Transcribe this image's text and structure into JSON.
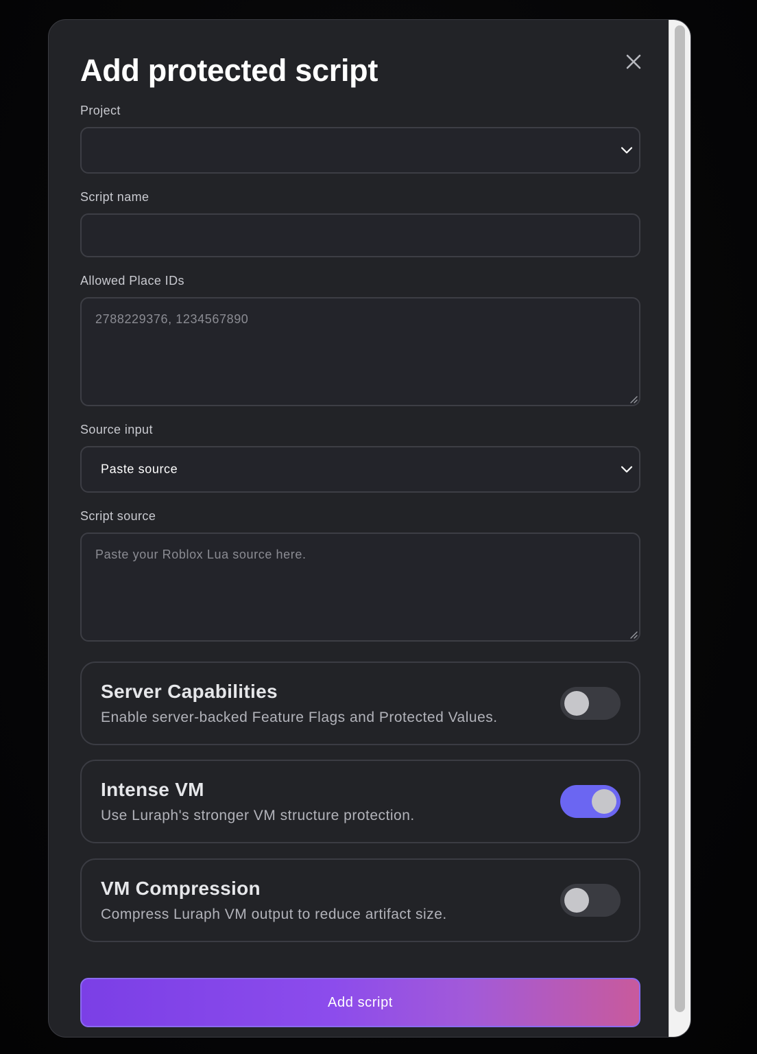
{
  "modal": {
    "title": "Add protected script",
    "close_icon": "close-icon"
  },
  "form": {
    "project": {
      "label": "Project",
      "value": "",
      "icon": "chevron-down-icon"
    },
    "script_name": {
      "label": "Script name",
      "value": "",
      "placeholder": ""
    },
    "allowed_place_ids": {
      "label": "Allowed Place IDs",
      "value": "",
      "placeholder": "2788229376, 1234567890"
    },
    "source_input": {
      "label": "Source input",
      "value": "Paste source",
      "icon": "chevron-down-icon"
    },
    "script_source": {
      "label": "Script source",
      "value": "",
      "placeholder": "Paste your Roblox Lua source here."
    }
  },
  "options": [
    {
      "title": "Server Capabilities",
      "description": "Enable server-backed Feature Flags and Protected Values.",
      "enabled": false
    },
    {
      "title": "Intense VM",
      "description": "Use Luraph's stronger VM structure protection.",
      "enabled": true
    },
    {
      "title": "VM Compression",
      "description": "Compress Luraph VM output to reduce artifact size.",
      "enabled": false
    }
  ],
  "submit": {
    "label": "Add script"
  },
  "colors": {
    "modal_bg": "#222327",
    "toggle_on": "#6b66f2",
    "toggle_off": "#3a3b41",
    "gradient_start": "#7b3fe6",
    "gradient_end": "#c85a9c"
  }
}
